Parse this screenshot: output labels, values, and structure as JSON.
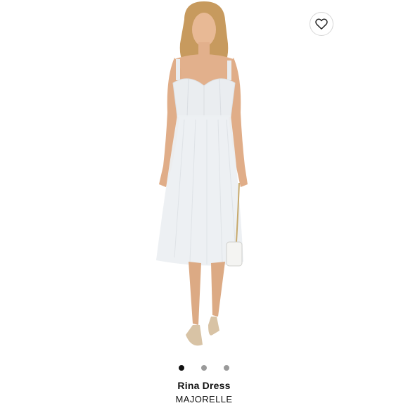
{
  "product": {
    "name": "Rina Dress",
    "brand": "MAJORELLE"
  },
  "wishlist": {
    "icon": "heart-icon"
  },
  "carousel": {
    "total": 3,
    "active_index": 0
  },
  "colors": {
    "dress": "#e9ecef",
    "skin": "#e2b08c",
    "hair": "#c79a5e",
    "dot_active": "#111111",
    "dot_inactive": "#9a9a9a"
  }
}
